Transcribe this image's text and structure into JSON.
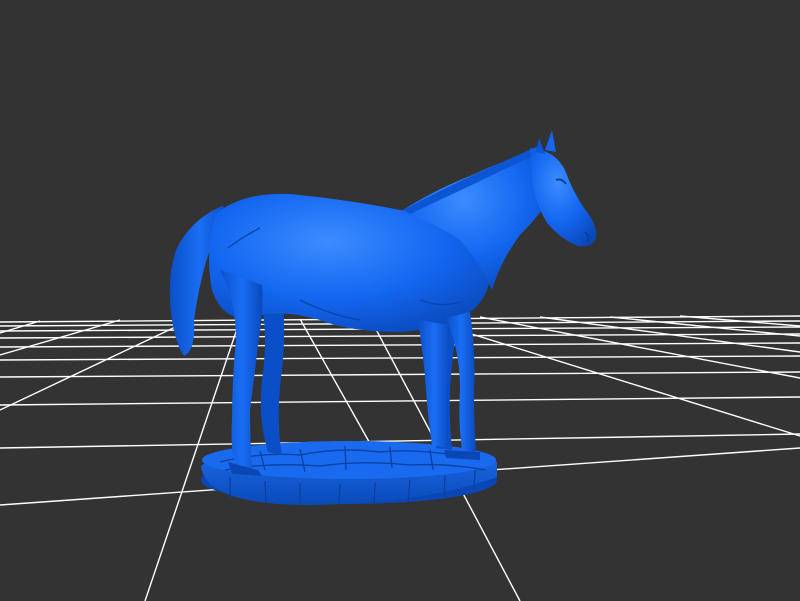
{
  "viewer": {
    "background_color": "#333333",
    "grid_color": "#ffffff",
    "model_color": "#0a5ee6",
    "model_name": "horse-on-cobblestone-base"
  }
}
